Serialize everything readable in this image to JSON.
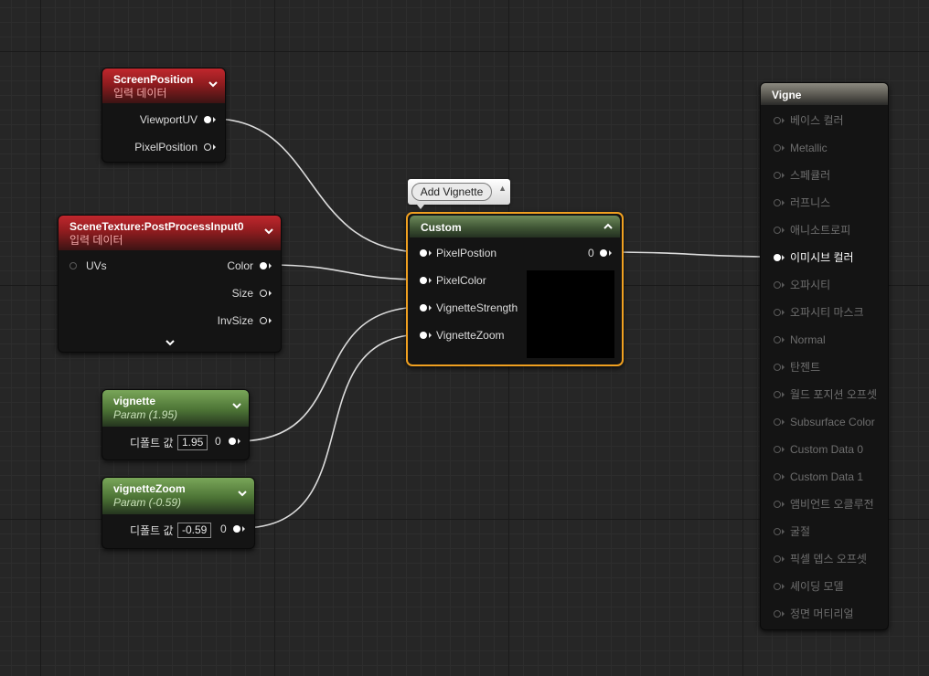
{
  "comment_bubble": {
    "label": "Add Vignette"
  },
  "screen_position": {
    "title": "ScreenPosition",
    "subtitle": "입력 데이터",
    "outputs": [
      "ViewportUV",
      "PixelPosition"
    ]
  },
  "scene_texture": {
    "title": "SceneTexture:PostProcessInput0",
    "subtitle": "입력 데이터",
    "input": "UVs",
    "outputs": [
      "Color",
      "Size",
      "InvSize"
    ]
  },
  "vignette": {
    "title": "vignette",
    "subtitle": "Param (1.95)",
    "default_label": "디폴트 값",
    "default_value": "1.95",
    "output": "0"
  },
  "vignette_zoom": {
    "title": "vignetteZoom",
    "subtitle": "Param (-0.59)",
    "default_label": "디폴트 값",
    "default_value": "-0.59",
    "output": "0"
  },
  "custom": {
    "title": "Custom",
    "inputs": [
      "PixelPostion",
      "PixelColor",
      "VignetteStrength",
      "VignetteZoom"
    ],
    "output": "0"
  },
  "result": {
    "title": "Vigne",
    "inputs": [
      "베이스 컬러",
      "Metallic",
      "스페큘러",
      "러프니스",
      "애니소트로피",
      "이미시브 컬러",
      "오파시티",
      "오파시티 마스크",
      "Normal",
      "탄젠트",
      "월드 포지션 오프셋",
      "Subsurface Color",
      "Custom Data 0",
      "Custom Data 1",
      "앰비언트 오클루전",
      "굴절",
      "픽셀 뎁스 오프셋",
      "셰이딩 모델",
      "정면 머티리얼"
    ]
  },
  "colors": {
    "param_header": "#5d8a43",
    "input_header": "#b4242a",
    "selection": "#f0a020",
    "wire": "#dcdcdc"
  }
}
